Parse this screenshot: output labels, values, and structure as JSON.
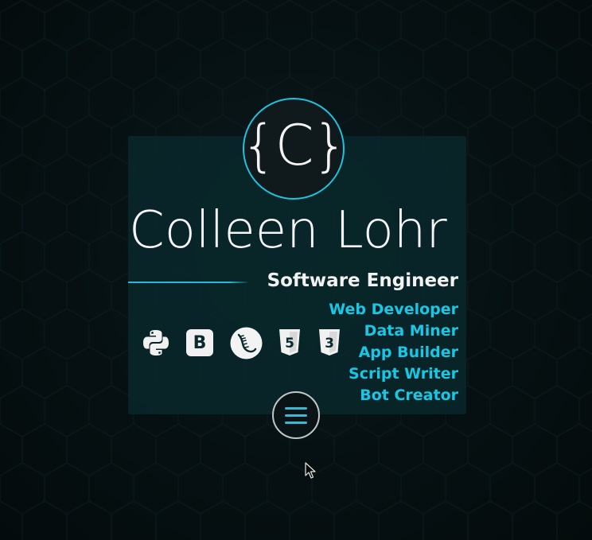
{
  "logo": {
    "text": "{C}",
    "icon": "brace-c-logo-icon"
  },
  "name": "Colleen Lohr",
  "title": "Software Engineer",
  "roles": [
    "Web Developer",
    "Data Miner",
    "App Builder",
    "Script Writer",
    "Bot Creator"
  ],
  "tech_icons": {
    "python": {
      "icon": "python-icon",
      "letter": ""
    },
    "bootstrap": {
      "icon": "bootstrap-icon",
      "letter": "B"
    },
    "flask": {
      "icon": "flask-icon",
      "letter": ""
    },
    "html5": {
      "icon": "html5-icon",
      "letter": "5"
    },
    "css3": {
      "icon": "css3-icon",
      "letter": "3"
    }
  },
  "menu": {
    "icon": "hamburger-menu-icon"
  },
  "colors": {
    "accent": "#16c8e6",
    "background": "#061012",
    "card": "#08282c",
    "text": "#f2f2f2"
  }
}
